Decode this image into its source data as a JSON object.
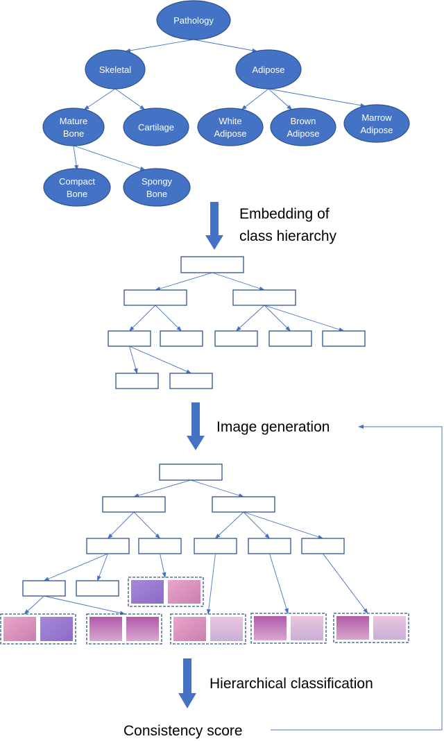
{
  "hierarchy": {
    "nodes": [
      {
        "id": "pathology",
        "lines": [
          "Pathology"
        ]
      },
      {
        "id": "skeletal",
        "lines": [
          "Skeletal"
        ]
      },
      {
        "id": "adipose",
        "lines": [
          "Adipose"
        ]
      },
      {
        "id": "mature-bone",
        "lines": [
          "Mature",
          "Bone"
        ]
      },
      {
        "id": "cartilage",
        "lines": [
          "Cartilage"
        ]
      },
      {
        "id": "white-adipose",
        "lines": [
          "White",
          "Adipose"
        ]
      },
      {
        "id": "brown-adipose",
        "lines": [
          "Brown",
          "Adipose"
        ]
      },
      {
        "id": "marrow-adipose",
        "lines": [
          "Marrow",
          "Adipose"
        ]
      },
      {
        "id": "compact-bone",
        "lines": [
          "Compact",
          "Bone"
        ]
      },
      {
        "id": "spongy-bone",
        "lines": [
          "Spongy",
          "Bone"
        ]
      }
    ],
    "edges": [
      [
        "pathology",
        "skeletal"
      ],
      [
        "pathology",
        "adipose"
      ],
      [
        "skeletal",
        "mature-bone"
      ],
      [
        "skeletal",
        "cartilage"
      ],
      [
        "adipose",
        "white-adipose"
      ],
      [
        "adipose",
        "brown-adipose"
      ],
      [
        "adipose",
        "marrow-adipose"
      ],
      [
        "mature-bone",
        "compact-bone"
      ],
      [
        "mature-bone",
        "spongy-bone"
      ]
    ]
  },
  "steps": {
    "embedding_line1": "Embedding of",
    "embedding_line2": "class hierarchy",
    "image_generation": "Image generation",
    "hierarchical_classification": "Hierarchical classification",
    "consistency_score": "Consistency score"
  },
  "colors": {
    "node_fill": "#4472c4",
    "arrow": "#4472c4",
    "box_stroke": "#2f528f"
  }
}
